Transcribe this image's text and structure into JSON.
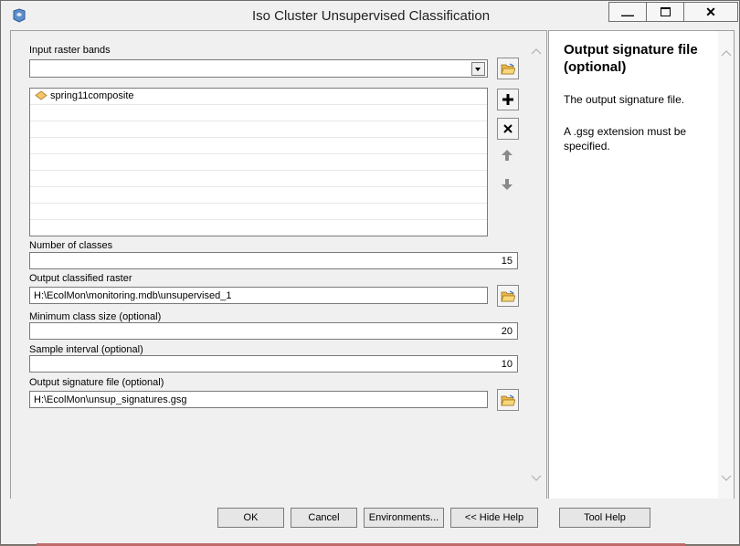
{
  "window": {
    "title": "Iso Cluster Unsupervised Classification"
  },
  "fields": {
    "input_raster_bands": {
      "label": "Input raster bands",
      "value": ""
    },
    "raster_list": [
      "spring11composite"
    ],
    "number_of_classes": {
      "label": "Number of classes",
      "value": "15"
    },
    "output_classified_raster": {
      "label": "Output classified raster",
      "value": "H:\\EcolMon\\monitoring.mdb\\unsupervised_1"
    },
    "minimum_class_size": {
      "label": "Minimum class size (optional)",
      "value": "20"
    },
    "sample_interval": {
      "label": "Sample interval (optional)",
      "value": "10"
    },
    "output_signature_file": {
      "label": "Output signature file (optional)",
      "value": "H:\\EcolMon\\unsup_signatures.gsg"
    }
  },
  "buttons": {
    "ok": "OK",
    "cancel": "Cancel",
    "environments": "Environments...",
    "hide_help": "<< Hide Help",
    "tool_help": "Tool Help"
  },
  "help": {
    "title": "Output signature file (optional)",
    "paragraph1": "The output signature file.",
    "paragraph2": "A .gsg extension must be specified."
  },
  "icons": [
    "toolbox-icon",
    "folder-open-icon",
    "add-icon",
    "remove-icon",
    "move-up-icon",
    "move-down-icon",
    "raster-icon",
    "minimize-icon",
    "maximize-icon",
    "close-icon"
  ],
  "colors": {
    "accent_folder": "#e8b84a",
    "window_bg": "#f0f0f0"
  }
}
